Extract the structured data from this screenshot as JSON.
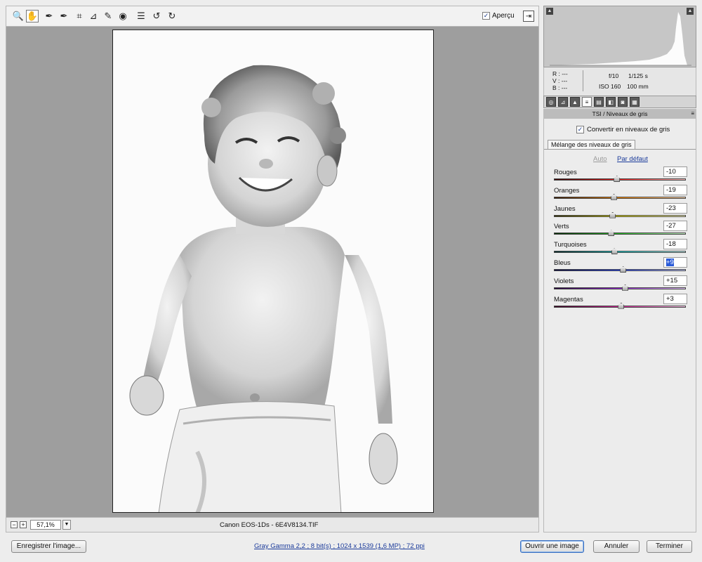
{
  "toolbar": {
    "tools": [
      {
        "icon": "zoom-icon",
        "glyph": "🔍"
      },
      {
        "icon": "hand-icon",
        "glyph": "✋",
        "active": true
      },
      {
        "icon": "white-balance-icon",
        "glyph": "✒"
      },
      {
        "icon": "color-sampler-icon",
        "glyph": "✒"
      },
      {
        "icon": "crop-icon",
        "glyph": "⌗"
      },
      {
        "icon": "straighten-icon",
        "glyph": "⊿"
      },
      {
        "icon": "retouch-icon",
        "glyph": "✎"
      },
      {
        "icon": "red-eye-icon",
        "glyph": "◉"
      },
      {
        "icon": "preferences-icon",
        "glyph": "☰"
      },
      {
        "icon": "rotate-left-icon",
        "glyph": "↺"
      },
      {
        "icon": "rotate-right-icon",
        "glyph": "↻"
      }
    ],
    "preview_label": "Aperçu",
    "preview_checked": "✓",
    "fullscreen_glyph": "⇥"
  },
  "status": {
    "zoom_out": "−",
    "zoom_in": "+",
    "zoom_value": "57,1%",
    "zoom_dropdown": "▼",
    "camera_info": "Canon EOS-1Ds  -  6E4V8134.TIF"
  },
  "histogram": {
    "shadow_clip": "▲",
    "highlight_clip": "▲"
  },
  "readout": {
    "r": "R :   ---",
    "v": "V :   ---",
    "b": "B :   ---",
    "aperture": "f/10",
    "shutter": "1/125 s",
    "iso": "ISO 160",
    "focal": "100 mm"
  },
  "panel": {
    "tabs": [
      "◎",
      "⊿",
      "▲",
      "≡",
      "▤",
      "◧",
      "◙",
      "▦"
    ],
    "active_tab": 3,
    "title": "TSI / Niveaux de gris",
    "menu_glyph": "≡",
    "convert_label": "Convertir en niveaux de gris",
    "convert_checked": "✓",
    "subtab": "Mélange des niveaux de gris",
    "auto_link": "Auto",
    "default_link": "Par défaut",
    "sliders": [
      {
        "label": "Rouges",
        "value": "-10",
        "level": -10,
        "colors": [
          "#3a0000",
          "#ff2020",
          "#ffc0c0"
        ]
      },
      {
        "label": "Oranges",
        "value": "-19",
        "level": -19,
        "colors": [
          "#3a1800",
          "#ff8a00",
          "#ffd8b0"
        ]
      },
      {
        "label": "Jaunes",
        "value": "-23",
        "level": -23,
        "colors": [
          "#353000",
          "#e8e000",
          "#fffcc0"
        ]
      },
      {
        "label": "Verts",
        "value": "-27",
        "level": -27,
        "colors": [
          "#002a00",
          "#20c020",
          "#c8f4c8"
        ]
      },
      {
        "label": "Turquoises",
        "value": "-18",
        "level": -18,
        "colors": [
          "#002a2a",
          "#10c8c8",
          "#c8f4f4"
        ]
      },
      {
        "label": "Bleus",
        "value": "+9",
        "level": 9,
        "selected": true,
        "colors": [
          "#00003a",
          "#2040ff",
          "#c8d0ff"
        ]
      },
      {
        "label": "Violets",
        "value": "+15",
        "level": 15,
        "colors": [
          "#22003a",
          "#9a20e0",
          "#e8c8ff"
        ]
      },
      {
        "label": "Magentas",
        "value": "+3",
        "level": 3,
        "colors": [
          "#3a0022",
          "#e020a0",
          "#ffc8ec"
        ]
      }
    ]
  },
  "footer": {
    "save_label": "Enregistrer l'image...",
    "workflow": "Gray Gamma 2,2 ; 8 bit(s) ; 1024 x 1539 (1,6 MP) ; 72 ppi",
    "open_label": "Ouvrir une image",
    "cancel_label": "Annuler",
    "done_label": "Terminer"
  }
}
